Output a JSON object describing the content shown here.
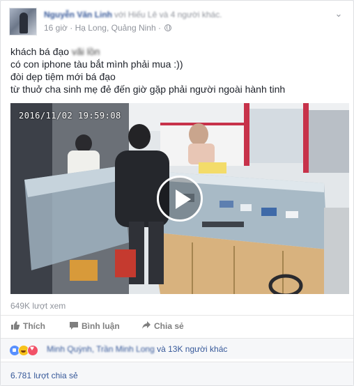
{
  "post": {
    "author": "Nguyễn Văn Linh",
    "with_text": "với Hiếu Lê và 4 người khác.",
    "time": "16 giờ",
    "location": "Hạ Long, Quảng Ninh",
    "separator": "·",
    "icons": {
      "privacy": "globe-icon",
      "menu": "chevron-down-icon"
    },
    "lines": [
      "khách bá đạo",
      "có con iphone tàu bắt mình phải mua :))",
      "đòi dẹp tiệm mới bá đạo",
      "từ thuở cha sinh mẹ đẻ đến giờ gặp phải người ngoài hành tinh"
    ],
    "blurred_word": "vãi lồn"
  },
  "video": {
    "timestamp": "2016/11/02 19:59:08",
    "views": "649K lượt xem",
    "play_icon": "play-icon"
  },
  "actions": {
    "like": "Thích",
    "comment": "Bình luận",
    "share": "Chia sẻ"
  },
  "reactions": {
    "types": [
      "like",
      "haha",
      "love"
    ],
    "names": "Minh Quỳnh, Trần Minh Long",
    "rest": "và 13K người khác"
  },
  "shares": "6.781 lượt chia sẻ",
  "colors": {
    "link": "#365899",
    "meta": "#90949c",
    "text": "#1d2129",
    "like_blue": "#5890ff"
  }
}
